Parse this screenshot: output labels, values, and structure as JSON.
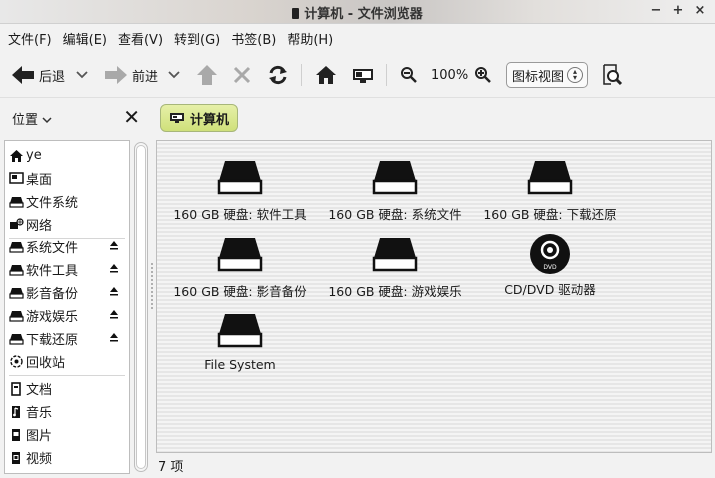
{
  "window": {
    "title": "计算机 - 文件浏览器",
    "minimize": "−",
    "maximize": "+",
    "close": "×"
  },
  "menubar": [
    {
      "label": "文件(F)"
    },
    {
      "label": "编辑(E)"
    },
    {
      "label": "查看(V)"
    },
    {
      "label": "转到(G)"
    },
    {
      "label": "书签(B)"
    },
    {
      "label": "帮助(H)"
    }
  ],
  "toolbar": {
    "back": "后退",
    "forward": "前进",
    "zoom": "100%",
    "view_mode": "图标视图"
  },
  "sidebar": {
    "header": "位置",
    "places": [
      {
        "label": "ye",
        "icon": "home-icon"
      },
      {
        "label": "桌面",
        "icon": "desktop-icon"
      },
      {
        "label": "文件系统",
        "icon": "drive-icon"
      },
      {
        "label": "网络",
        "icon": "network-icon"
      }
    ],
    "devices": [
      {
        "label": "系统文件"
      },
      {
        "label": "软件工具"
      },
      {
        "label": "影音备份"
      },
      {
        "label": "游戏娱乐"
      },
      {
        "label": "下载还原"
      }
    ],
    "trash": "回收站",
    "bookmarks": [
      {
        "label": "文档"
      },
      {
        "label": "音乐"
      },
      {
        "label": "图片"
      },
      {
        "label": "视频"
      }
    ]
  },
  "pathbar": {
    "current": "计算机"
  },
  "files": [
    {
      "label": "160 GB 硬盘: 软件工具",
      "icon": "hard-drive-icon"
    },
    {
      "label": "160 GB 硬盘: 系统文件",
      "icon": "hard-drive-icon"
    },
    {
      "label": "160 GB 硬盘: 下载还原",
      "icon": "hard-drive-icon"
    },
    {
      "label": "160 GB 硬盘: 影音备份",
      "icon": "hard-drive-icon"
    },
    {
      "label": "160 GB 硬盘: 游戏娱乐",
      "icon": "hard-drive-icon"
    },
    {
      "label": "CD/DVD 驱动器",
      "icon": "dvd-icon",
      "disc_text": "DVD"
    },
    {
      "label": "File System",
      "icon": "hard-drive-icon"
    }
  ],
  "status": "7 项"
}
